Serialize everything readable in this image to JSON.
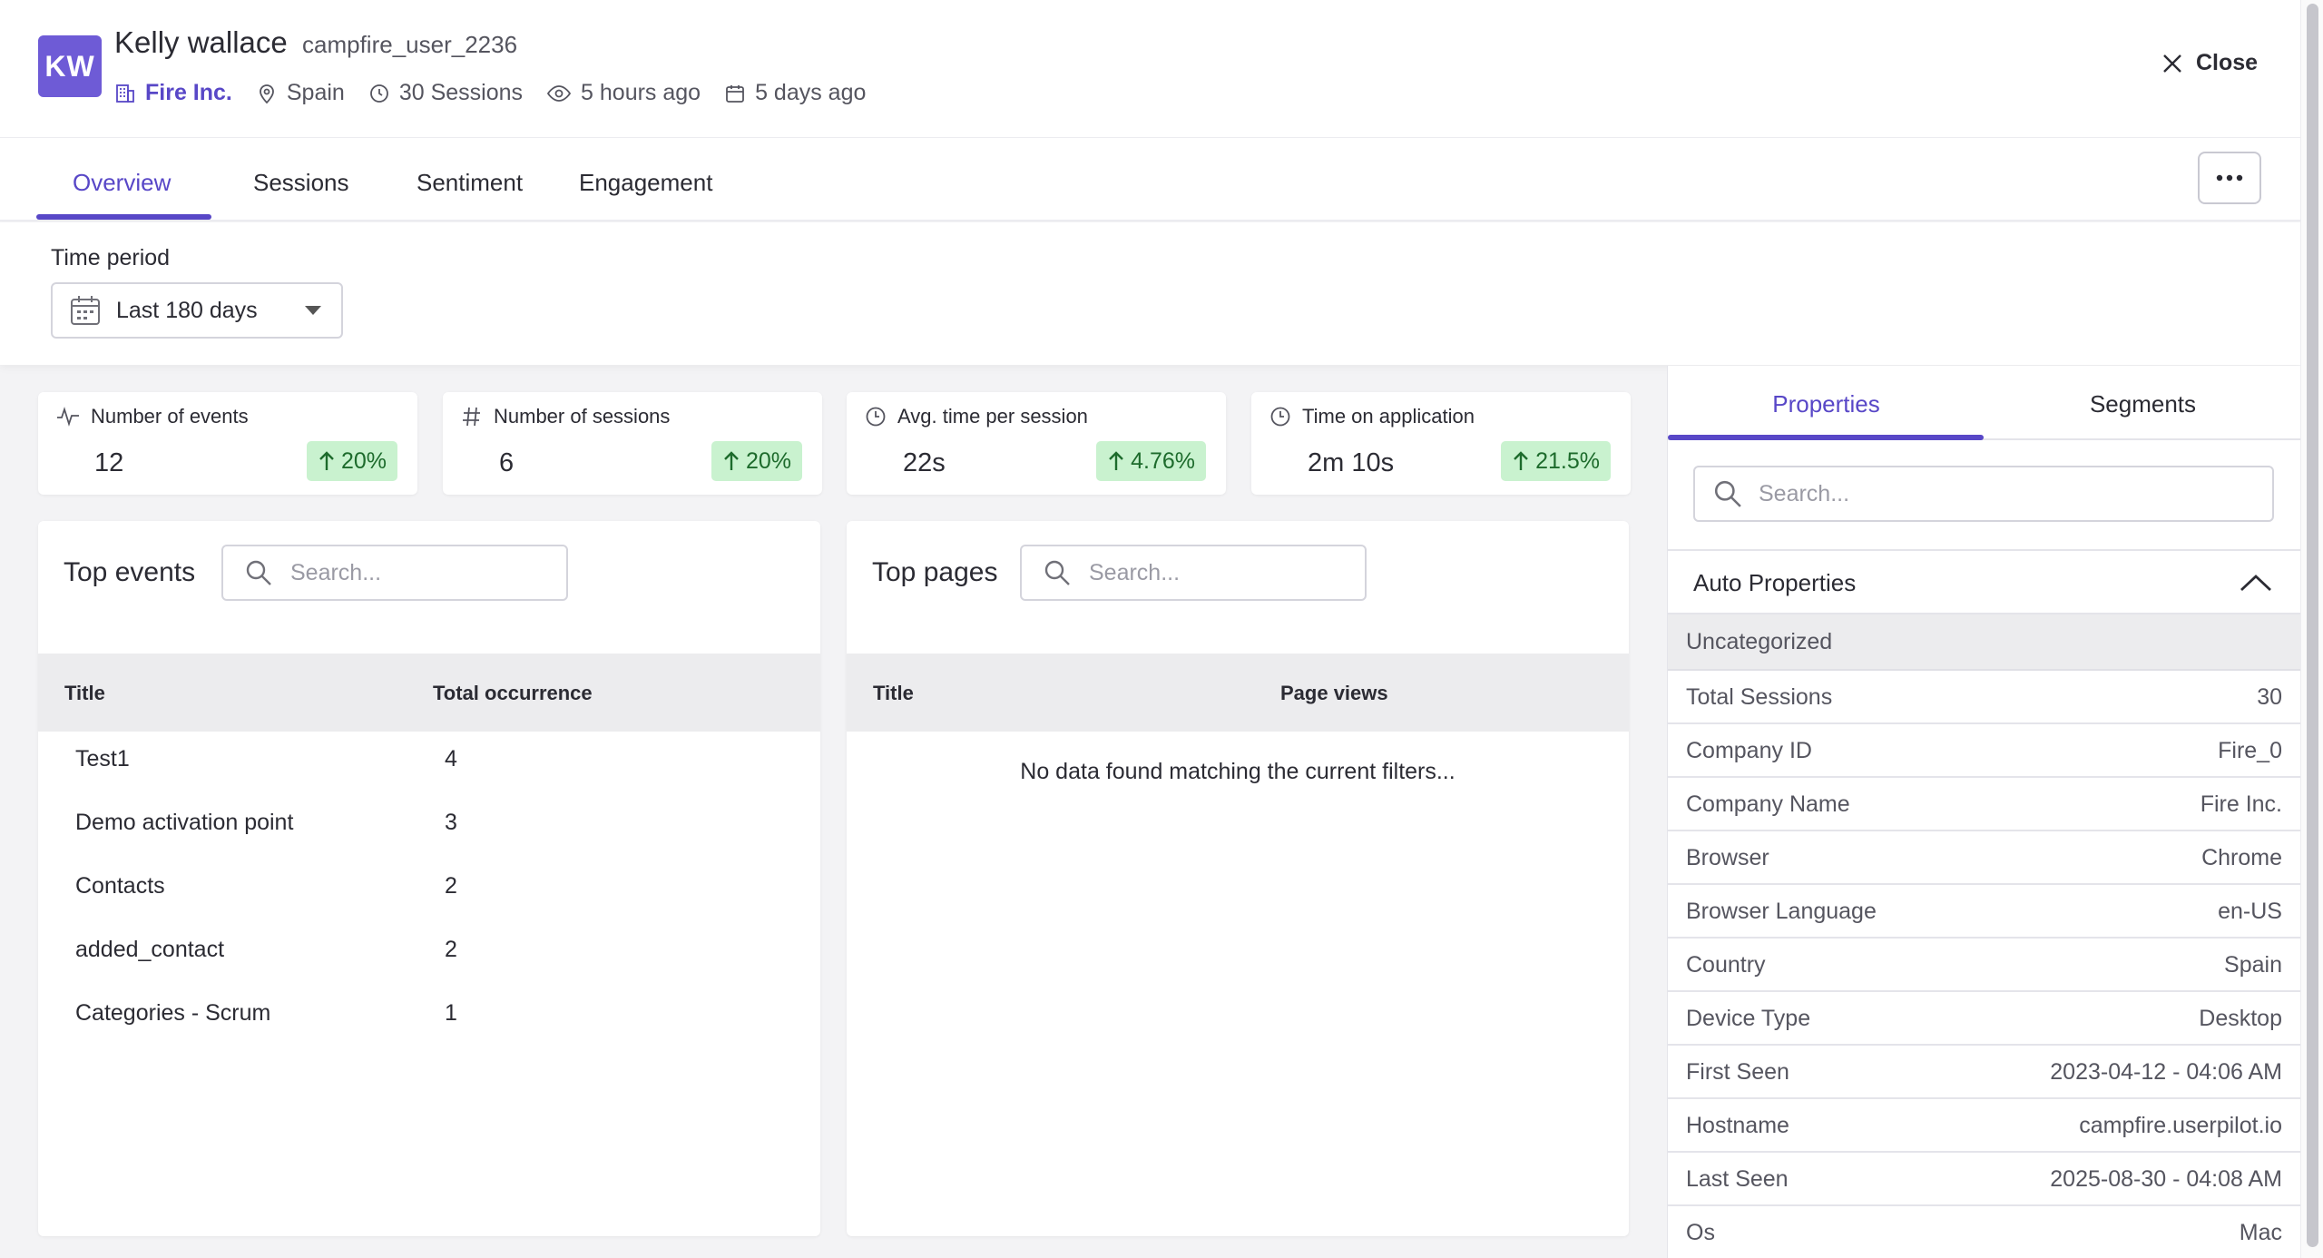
{
  "user": {
    "initials": "KW",
    "name": "Kelly wallace",
    "handle": "campfire_user_2236",
    "company": "Fire Inc.",
    "country": "Spain",
    "sessions": "30 Sessions",
    "last_seen": "5 hours ago",
    "first_seen": "5 days ago"
  },
  "header": {
    "close_label": "Close"
  },
  "tabs": [
    {
      "label": "Overview",
      "active": true
    },
    {
      "label": "Sessions"
    },
    {
      "label": "Sentiment"
    },
    {
      "label": "Engagement"
    }
  ],
  "time_period": {
    "label": "Time period",
    "value": "Last 180 days"
  },
  "stats": [
    {
      "title": "Number of events",
      "value": "12",
      "change": "20%",
      "icon": "activity-icon"
    },
    {
      "title": "Number of sessions",
      "value": "6",
      "change": "20%",
      "icon": "hash-icon"
    },
    {
      "title": "Avg. time per session",
      "value": "22s",
      "change": "4.76%",
      "icon": "clock-icon"
    },
    {
      "title": "Time on application",
      "value": "2m 10s",
      "change": "21.5%",
      "icon": "clock-icon"
    }
  ],
  "top_events": {
    "title": "Top events",
    "search_placeholder": "Search...",
    "columns": [
      "Title",
      "Total occurrence"
    ],
    "rows": [
      {
        "title": "Test1",
        "count": "4"
      },
      {
        "title": "Demo activation point",
        "count": "3"
      },
      {
        "title": "Contacts",
        "count": "2"
      },
      {
        "title": "added_contact",
        "count": "2"
      },
      {
        "title": "Categories - Scrum",
        "count": "1"
      }
    ]
  },
  "top_pages": {
    "title": "Top pages",
    "search_placeholder": "Search...",
    "columns": [
      "Title",
      "Page views"
    ],
    "empty_message": "No data found matching the current filters..."
  },
  "side_panel": {
    "tabs": [
      "Properties",
      "Segments"
    ],
    "search_placeholder": "Search...",
    "section_title": "Auto Properties",
    "group_title": "Uncategorized",
    "properties": [
      {
        "key": "Total Sessions",
        "value": "30"
      },
      {
        "key": "Company ID",
        "value": "Fire_0"
      },
      {
        "key": "Company Name",
        "value": "Fire Inc."
      },
      {
        "key": "Browser",
        "value": "Chrome"
      },
      {
        "key": "Browser Language",
        "value": "en-US"
      },
      {
        "key": "Country",
        "value": "Spain"
      },
      {
        "key": "Device Type",
        "value": "Desktop"
      },
      {
        "key": "First Seen",
        "value": "2023-04-12 - 04:06 AM"
      },
      {
        "key": "Hostname",
        "value": "campfire.userpilot.io"
      },
      {
        "key": "Last Seen",
        "value": "2025-08-30 - 04:08 AM"
      },
      {
        "key": "Os",
        "value": "Mac"
      }
    ]
  },
  "colors": {
    "accent": "#5847c7",
    "avatar": "#6e5bd6",
    "badge_bg": "#c9f2cf",
    "badge_text": "#1d6b2c"
  }
}
